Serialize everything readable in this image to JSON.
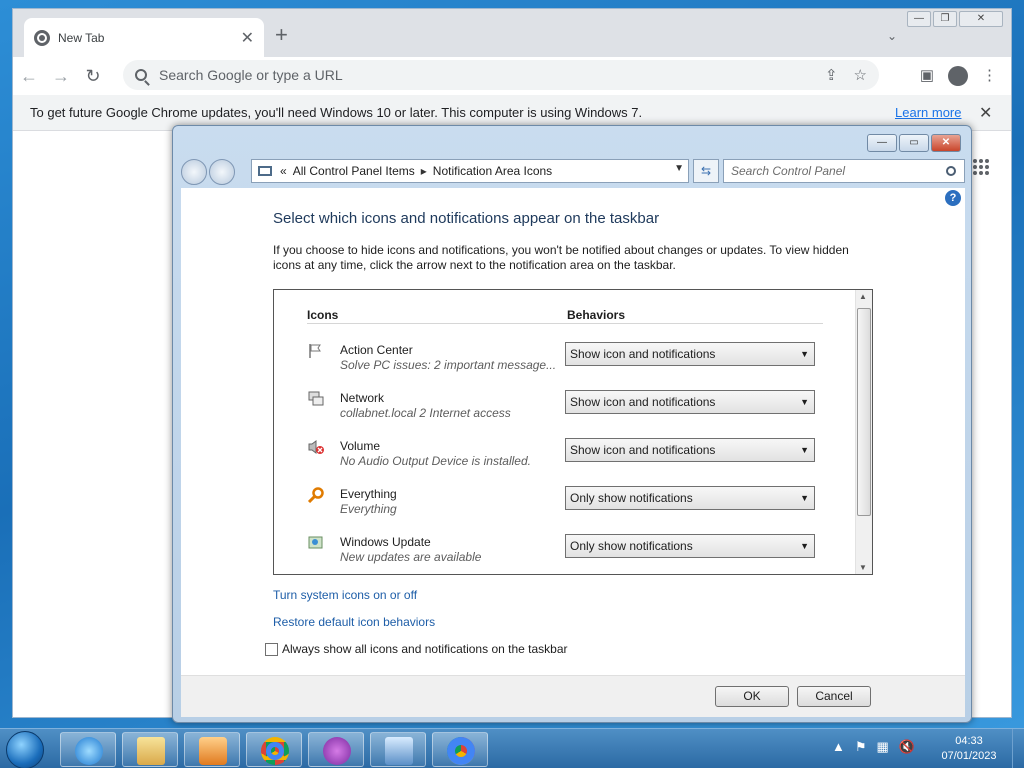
{
  "chrome": {
    "tab_title": "New Tab",
    "tab_close": "✕",
    "new_tab": "+",
    "tab_search": "⌄",
    "omnibox_placeholder": "Search Google or type a URL",
    "infobar_message": "To get future Google Chrome updates, you'll need Windows 10 or later. This computer is using Windows 7.",
    "infobar_link": "Learn more",
    "infobar_close": "✕"
  },
  "control_panel": {
    "breadcrumb": [
      "All Control Panel Items",
      "Notification Area Icons"
    ],
    "breadcrumb_prefix": "«",
    "search_placeholder": "Search Control Panel",
    "help": "?",
    "heading": "Select which icons and notifications appear on the taskbar",
    "description": "If you choose to hide icons and notifications, you won't be notified about changes or updates. To view hidden icons at any time, click the arrow next to the notification area on the taskbar.",
    "columns": {
      "icons": "Icons",
      "behaviors": "Behaviors"
    },
    "rows": [
      {
        "name": "Action Center",
        "detail": "Solve PC issues: 2 important message...",
        "behavior": "Show icon and notifications",
        "icon": "flag-icon"
      },
      {
        "name": "Network",
        "detail": "collabnet.local  2 Internet access",
        "behavior": "Show icon and notifications",
        "icon": "network-icon"
      },
      {
        "name": "Volume",
        "detail": "No Audio Output Device is installed.",
        "behavior": "Show icon and notifications",
        "icon": "speaker-muted-icon"
      },
      {
        "name": "Everything",
        "detail": "Everything",
        "behavior": "Only show notifications",
        "icon": "magnifier-icon"
      },
      {
        "name": "Windows Update",
        "detail": "New updates are available",
        "behavior": "Only show notifications",
        "icon": "windows-update-icon"
      }
    ],
    "link_system_icons": "Turn system icons on or off",
    "link_restore": "Restore default icon behaviors",
    "checkbox_label": "Always show all icons and notifications on the taskbar",
    "checkbox_checked": false,
    "ok": "OK",
    "cancel": "Cancel"
  },
  "taskbar": {
    "time": "04:33",
    "date": "07/01/2023",
    "apps": [
      "internet-explorer-icon",
      "file-explorer-icon",
      "media-player-icon",
      "chrome-icon",
      "app-icon",
      "remote-desktop-icon",
      "chrome-icon"
    ]
  },
  "colors": {
    "accent_link": "#1e5ea8",
    "heading": "#1e395b",
    "chrome_link": "#1a73e8"
  }
}
